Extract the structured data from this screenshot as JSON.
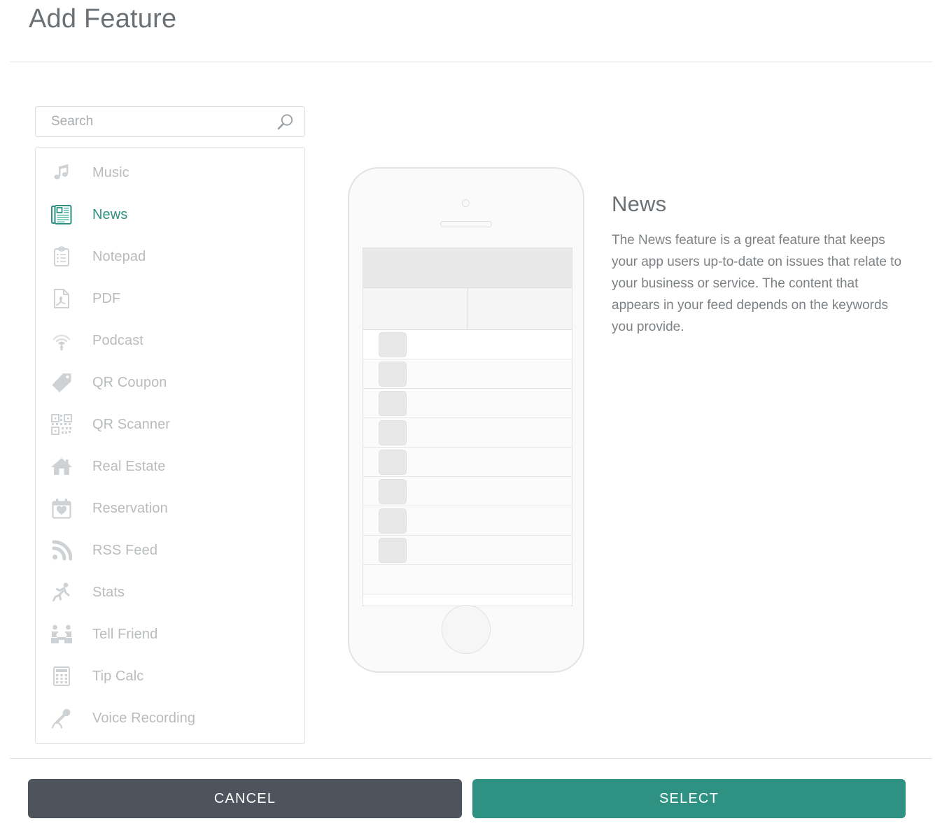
{
  "dialog": {
    "title": "Add Feature"
  },
  "search": {
    "placeholder": "Search",
    "value": "",
    "icon": "search-icon"
  },
  "feature_list": {
    "selected": "News",
    "items": [
      {
        "label": "Music",
        "icon": "music-note-icon",
        "selected": false
      },
      {
        "label": "News",
        "icon": "newspaper-icon",
        "selected": true
      },
      {
        "label": "Notepad",
        "icon": "clipboard-icon",
        "selected": false
      },
      {
        "label": "PDF",
        "icon": "pdf-file-icon",
        "selected": false
      },
      {
        "label": "Podcast",
        "icon": "podcast-icon",
        "selected": false
      },
      {
        "label": "QR Coupon",
        "icon": "tag-icon",
        "selected": false
      },
      {
        "label": "QR Scanner",
        "icon": "qr-code-icon",
        "selected": false
      },
      {
        "label": "Real Estate",
        "icon": "house-icon",
        "selected": false
      },
      {
        "label": "Reservation",
        "icon": "calendar-heart-icon",
        "selected": false
      },
      {
        "label": "RSS Feed",
        "icon": "rss-icon",
        "selected": false
      },
      {
        "label": "Stats",
        "icon": "running-person-icon",
        "selected": false
      },
      {
        "label": "Tell Friend",
        "icon": "two-people-icon",
        "selected": false
      },
      {
        "label": "Tip Calc",
        "icon": "calculator-icon",
        "selected": false
      },
      {
        "label": "Voice Recording",
        "icon": "microphone-icon",
        "selected": false
      }
    ]
  },
  "preview": {
    "device": "phone-mockup",
    "screen_rows": 8
  },
  "detail": {
    "title": "News",
    "description": "The News feature is a great feature that keeps your app users up-to-date on issues that relate to your business or service. The content that appears in your feed depends on the keywords you provide."
  },
  "footer": {
    "cancel_label": "CANCEL",
    "select_label": "SELECT"
  },
  "colors": {
    "accent": "#2e9182",
    "cancel": "#4d545b",
    "text": "#6b7074",
    "muted": "#b9bcbe",
    "border": "#e0e0e0"
  }
}
